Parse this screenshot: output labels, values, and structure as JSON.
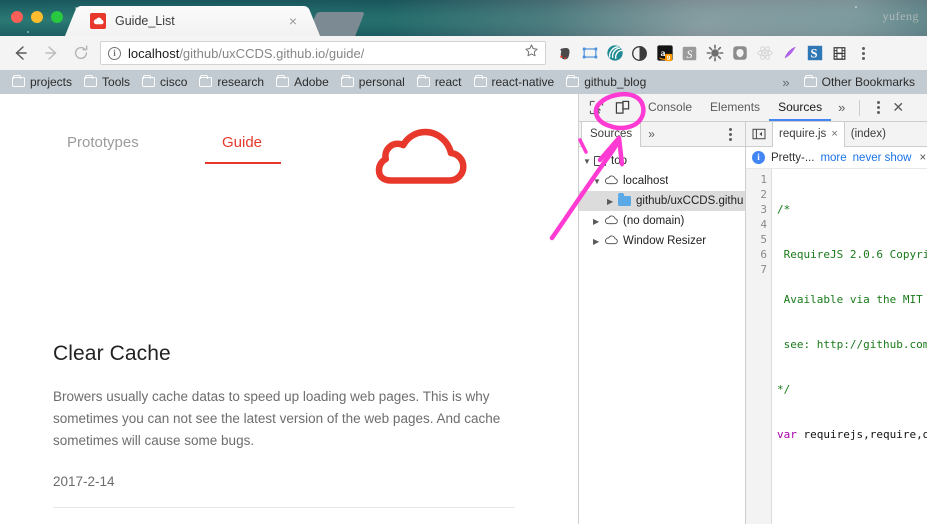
{
  "desktop": {
    "watermark": "yufeng"
  },
  "browser": {
    "tab": {
      "title": "Guide_List",
      "favicon": "cloud-icon",
      "close_label": "×"
    },
    "nav": {
      "back": "←",
      "forward": "→",
      "reload": "⟳"
    },
    "omnibox": {
      "security_icon": "info-icon",
      "host": "localhost",
      "path": "/github/uxCCDS.github.io/guide/",
      "bookmark_icon": "star-icon"
    },
    "extensions": [
      {
        "name": "evernote-icon"
      },
      {
        "name": "screenshot-icon"
      },
      {
        "name": "wave-icon"
      },
      {
        "name": "contrast-icon"
      },
      {
        "name": "amazon-icon",
        "badge": "9"
      },
      {
        "name": "script-icon"
      },
      {
        "name": "bug-icon"
      },
      {
        "name": "shield-icon"
      },
      {
        "name": "react-icon"
      },
      {
        "name": "feather-icon"
      },
      {
        "name": "s-icon"
      },
      {
        "name": "film-icon"
      }
    ],
    "menu_icon": "kebab-menu-icon",
    "bookmarks": [
      "projects",
      "Tools",
      "cisco",
      "research",
      "Adobe",
      "personal",
      "react",
      "react-native",
      "github_blog"
    ],
    "bookmarks_overflow": "»",
    "other_bookmarks": "Other Bookmarks"
  },
  "page": {
    "nav": [
      {
        "label": "Prototypes",
        "active": false
      },
      {
        "label": "Guide",
        "active": true
      }
    ],
    "logo": "cloud-logo",
    "article": {
      "title": "Clear Cache",
      "body": "Browers usually cache datas to speed up loading web pages. This is why sometimes you can not see the latest version of the web pages. And cache sometimes will cause some bugs.",
      "date": "2017-2-14"
    },
    "accent_color": "#e8382c"
  },
  "devtools": {
    "toolbar": {
      "inspect_icon": "inspect-element-icon",
      "device_icon": "device-toolbar-icon",
      "tabs": [
        {
          "label": "Console",
          "active": false
        },
        {
          "label": "Elements",
          "active": false
        },
        {
          "label": "Sources",
          "active": true
        }
      ],
      "overflow": "»",
      "menu_icon": "kebab-menu-icon",
      "close_icon": "close-icon",
      "close_label": "✕"
    },
    "navigator": {
      "tab": "Sources",
      "overflow": "»",
      "menu_icon": "kebab-menu-icon",
      "tree": [
        {
          "label": "top",
          "icon": "frame-icon",
          "arrow": "▼",
          "depth": 0,
          "selected": false
        },
        {
          "label": "localhost",
          "icon": "cloud-icon",
          "arrow": "▼",
          "depth": 1,
          "selected": false
        },
        {
          "label": "github/uxCCDS.githu",
          "icon": "folder-icon",
          "arrow": "▶",
          "depth": 2,
          "selected": true
        },
        {
          "label": "(no domain)",
          "icon": "cloud-icon",
          "arrow": "▶",
          "depth": 1,
          "selected": false
        },
        {
          "label": "Window Resizer",
          "icon": "cloud-icon",
          "arrow": "▶",
          "depth": 1,
          "selected": false
        }
      ]
    },
    "editor": {
      "panel_toggle_icon": "show-navigator-icon",
      "tabs": [
        {
          "label": "require.js",
          "active": true,
          "closable": true
        },
        {
          "label": "(index)",
          "active": false,
          "closable": false
        }
      ],
      "close_label": "×",
      "info_bar": {
        "icon": "info-icon",
        "text": "Pretty-...",
        "more": "more",
        "never_show": "never show",
        "dismiss": "×"
      },
      "line_numbers": [
        "1",
        "2",
        "3",
        "4",
        "5",
        "6",
        "7"
      ],
      "lines": [
        {
          "text": "/*",
          "type": "comment"
        },
        {
          "text": " RequireJS 2.0.6 Copyri",
          "type": "comment"
        },
        {
          "text": " Available via the MIT",
          "type": "comment"
        },
        {
          "text": " see: http://github.com",
          "type": "comment"
        },
        {
          "text": "*/",
          "type": "comment"
        },
        {
          "text": "var requirejs,require,d",
          "type": "code",
          "keyword": "var",
          "rest": " requirejs,require,d"
        },
        {
          "text": "",
          "type": "code"
        }
      ]
    }
  },
  "annotation": {
    "color": "#ff3bd4",
    "shapes": [
      "circle-highlight",
      "arrow"
    ]
  }
}
